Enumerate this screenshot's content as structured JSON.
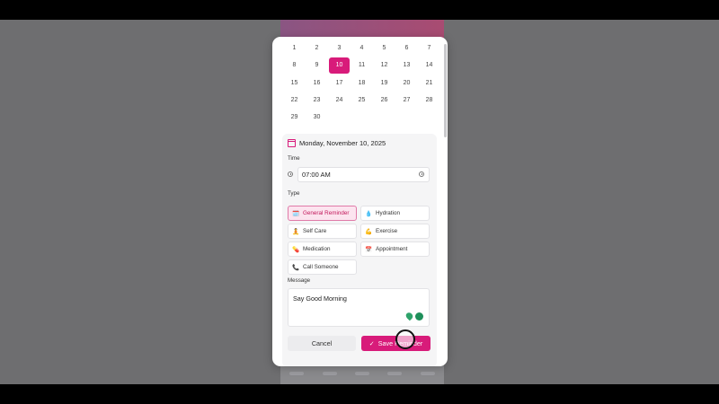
{
  "calendar": {
    "days": [
      "1",
      "2",
      "3",
      "4",
      "5",
      "6",
      "7",
      "8",
      "9",
      "10",
      "11",
      "12",
      "13",
      "14",
      "15",
      "16",
      "17",
      "18",
      "19",
      "20",
      "21",
      "22",
      "23",
      "24",
      "25",
      "26",
      "27",
      "28",
      "29",
      "30"
    ],
    "selected_day": "10"
  },
  "selected_date": "Monday, November 10, 2025",
  "time": {
    "label": "Time",
    "value": "07:00 AM"
  },
  "type": {
    "label": "Type",
    "options": [
      {
        "icon": "🗓️",
        "label": "General Reminder",
        "active": true
      },
      {
        "icon": "💧",
        "label": "Hydration",
        "active": false
      },
      {
        "icon": "🧘",
        "label": "Self Care",
        "active": false
      },
      {
        "icon": "💪",
        "label": "Exercise",
        "active": false
      },
      {
        "icon": "💊",
        "label": "Medication",
        "active": false
      },
      {
        "icon": "📅",
        "label": "Appointment",
        "active": false
      },
      {
        "icon": "📞",
        "label": "Call Someone",
        "active": false
      }
    ]
  },
  "message": {
    "label": "Message",
    "value": "Say Good Morning"
  },
  "actions": {
    "cancel": "Cancel",
    "save": "Save Reminder"
  },
  "colors": {
    "accent": "#d81b7a",
    "chip_active_bg": "#fce4ef"
  }
}
